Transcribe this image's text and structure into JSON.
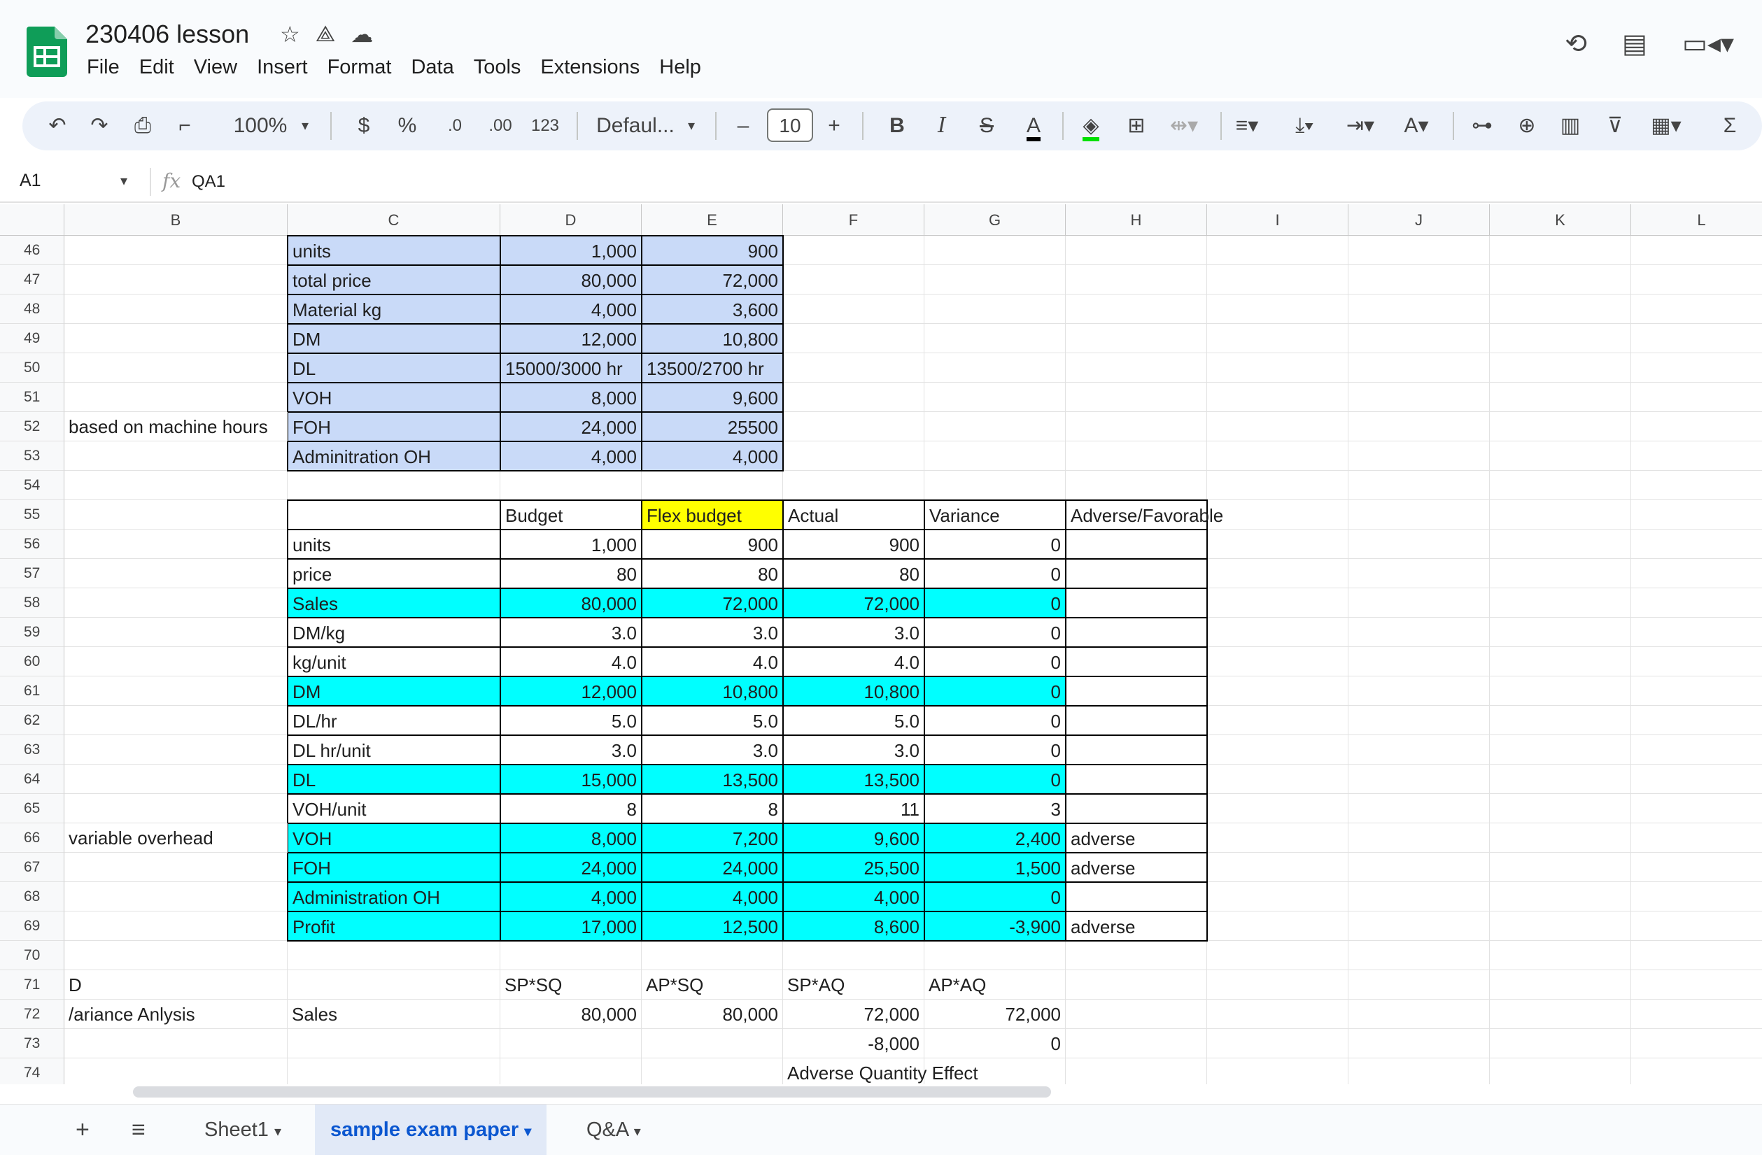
{
  "app": {
    "title": "230406 lesson",
    "menu": [
      "File",
      "Edit",
      "View",
      "Insert",
      "Format",
      "Data",
      "Tools",
      "Extensions",
      "Help"
    ],
    "zoom": "100%",
    "font": "Defaul...",
    "font_size": "10",
    "currency": "$",
    "percent": "%",
    "dec_less": ".0",
    "dec_more": ".00",
    "num_format": "123",
    "minus": "–",
    "plus": "+",
    "bold": "B",
    "italic": "I",
    "sigma": "Σ",
    "colors": {
      "accent": "#0b57d0",
      "blue_fill": "#c9daf8",
      "cyan_fill": "#00ffff",
      "yellow_fill": "#ffff00",
      "sheets_green": "#0f9d58"
    }
  },
  "formula": {
    "cell": "A1",
    "fx": "fx",
    "value": "QA1"
  },
  "columns": [
    "B",
    "C",
    "D",
    "E",
    "F",
    "G",
    "H",
    "I",
    "J",
    "K",
    "L"
  ],
  "rows": [
    "46",
    "47",
    "48",
    "49",
    "50",
    "51",
    "52",
    "53",
    "54",
    "55",
    "56",
    "57",
    "58",
    "59",
    "60",
    "61",
    "62",
    "63",
    "64",
    "65",
    "66",
    "67",
    "68",
    "69",
    "70",
    "71",
    "72",
    "73",
    "74"
  ],
  "table1": [
    [
      "units",
      "1,000",
      "900"
    ],
    [
      "total price",
      "80,000",
      "72,000"
    ],
    [
      "Material kg",
      "4,000",
      "3,600"
    ],
    [
      "DM",
      "12,000",
      "10,800"
    ],
    [
      "DL",
      "15000/3000 hr",
      "13500/2700 hr"
    ],
    [
      "VOH",
      "8,000",
      "9,600"
    ],
    [
      "FOH",
      "24,000",
      "25500"
    ],
    [
      "Adminitration OH",
      "4,000",
      "4,000"
    ]
  ],
  "notes": {
    "r52": "based on machine hours",
    "r66": "variable overhead",
    "r71": "D",
    "r72": "/ariance Anlysis"
  },
  "table2_header": [
    "",
    "Budget",
    "Flex budget",
    "Actual",
    "Variance",
    "Adverse/Favorable"
  ],
  "table2": [
    [
      "units",
      "1,000",
      "900",
      "900",
      "0",
      ""
    ],
    [
      "price",
      "80",
      "80",
      "80",
      "0",
      ""
    ],
    [
      "Sales",
      "80,000",
      "72,000",
      "72,000",
      "0",
      ""
    ],
    [
      "DM/kg",
      "3.0",
      "3.0",
      "3.0",
      "0",
      ""
    ],
    [
      "kg/unit",
      "4.0",
      "4.0",
      "4.0",
      "0",
      ""
    ],
    [
      "DM",
      "12,000",
      "10,800",
      "10,800",
      "0",
      ""
    ],
    [
      "DL/hr",
      "5.0",
      "5.0",
      "5.0",
      "0",
      ""
    ],
    [
      "DL hr/unit",
      "3.0",
      "3.0",
      "3.0",
      "0",
      ""
    ],
    [
      "DL",
      "15,000",
      "13,500",
      "13,500",
      "0",
      ""
    ],
    [
      "VOH/unit",
      "8",
      "8",
      "11",
      "3",
      ""
    ],
    [
      "VOH",
      "8,000",
      "7,200",
      "9,600",
      "2,400",
      "adverse"
    ],
    [
      "FOH",
      "24,000",
      "24,000",
      "25,500",
      "1,500",
      "adverse"
    ],
    [
      "Administration OH",
      "4,000",
      "4,000",
      "4,000",
      "0",
      ""
    ],
    [
      "Profit",
      "17,000",
      "12,500",
      "8,600",
      "-3,900",
      "adverse"
    ]
  ],
  "table2_highlight": [
    false,
    false,
    true,
    false,
    false,
    true,
    false,
    false,
    true,
    false,
    true,
    true,
    true,
    true
  ],
  "variance": {
    "r71": [
      "",
      "SP*SQ",
      "AP*SQ",
      "SP*AQ",
      "AP*AQ"
    ],
    "r72": [
      "Sales",
      "80,000",
      "80,000",
      "72,000",
      "72,000"
    ],
    "r73": [
      "",
      "",
      "",
      "-8,000",
      "0"
    ],
    "r74": [
      "",
      "",
      "",
      "Adverse Quantity Effect",
      ""
    ]
  },
  "sheets": {
    "add": "+",
    "list": "≡",
    "tabs": [
      "Sheet1",
      "sample exam paper",
      "Q&A"
    ],
    "active": 1
  }
}
